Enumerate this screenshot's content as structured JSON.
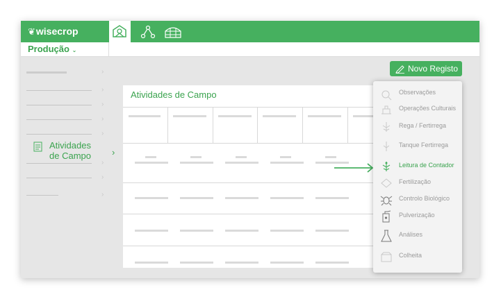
{
  "app": {
    "logo_text": "wisecrop",
    "brand_color": "#46b05f"
  },
  "nav": {
    "icons": [
      "home-farm-icon",
      "sensor-network-icon",
      "greenhouse-icon"
    ],
    "active": "home-farm-icon"
  },
  "subbar": {
    "title": "Produção",
    "dropdown_icon": "chevron-down-icon"
  },
  "sidebar": {
    "active_item": {
      "line1": "Atividades",
      "line2": "de Campo",
      "icon": "document-icon"
    }
  },
  "toolbar": {
    "new_record_label": "Novo Registo",
    "new_record_icon": "pencil-icon"
  },
  "card": {
    "title": "Atividades de Campo"
  },
  "menu": {
    "items": [
      {
        "label": "Observações",
        "icon": "observation-icon"
      },
      {
        "label": "Operações Culturais",
        "icon": "crop-operations-icon"
      },
      {
        "label": "Rega / Fertirrega",
        "icon": "irrigation-icon"
      },
      {
        "label": "Tanque Fertirrega",
        "icon": "tank-icon"
      },
      {
        "label": "Leitura de Contador",
        "icon": "meter-reading-icon",
        "active": true
      },
      {
        "label": "Fertilização",
        "icon": "fertilizer-icon"
      },
      {
        "label": "Controlo Biológico",
        "icon": "bug-icon"
      },
      {
        "label": "Pulverização",
        "icon": "sprayer-icon"
      },
      {
        "label": "Análises",
        "icon": "flask-icon"
      },
      {
        "label": "Colheita",
        "icon": "harvest-icon"
      }
    ]
  }
}
